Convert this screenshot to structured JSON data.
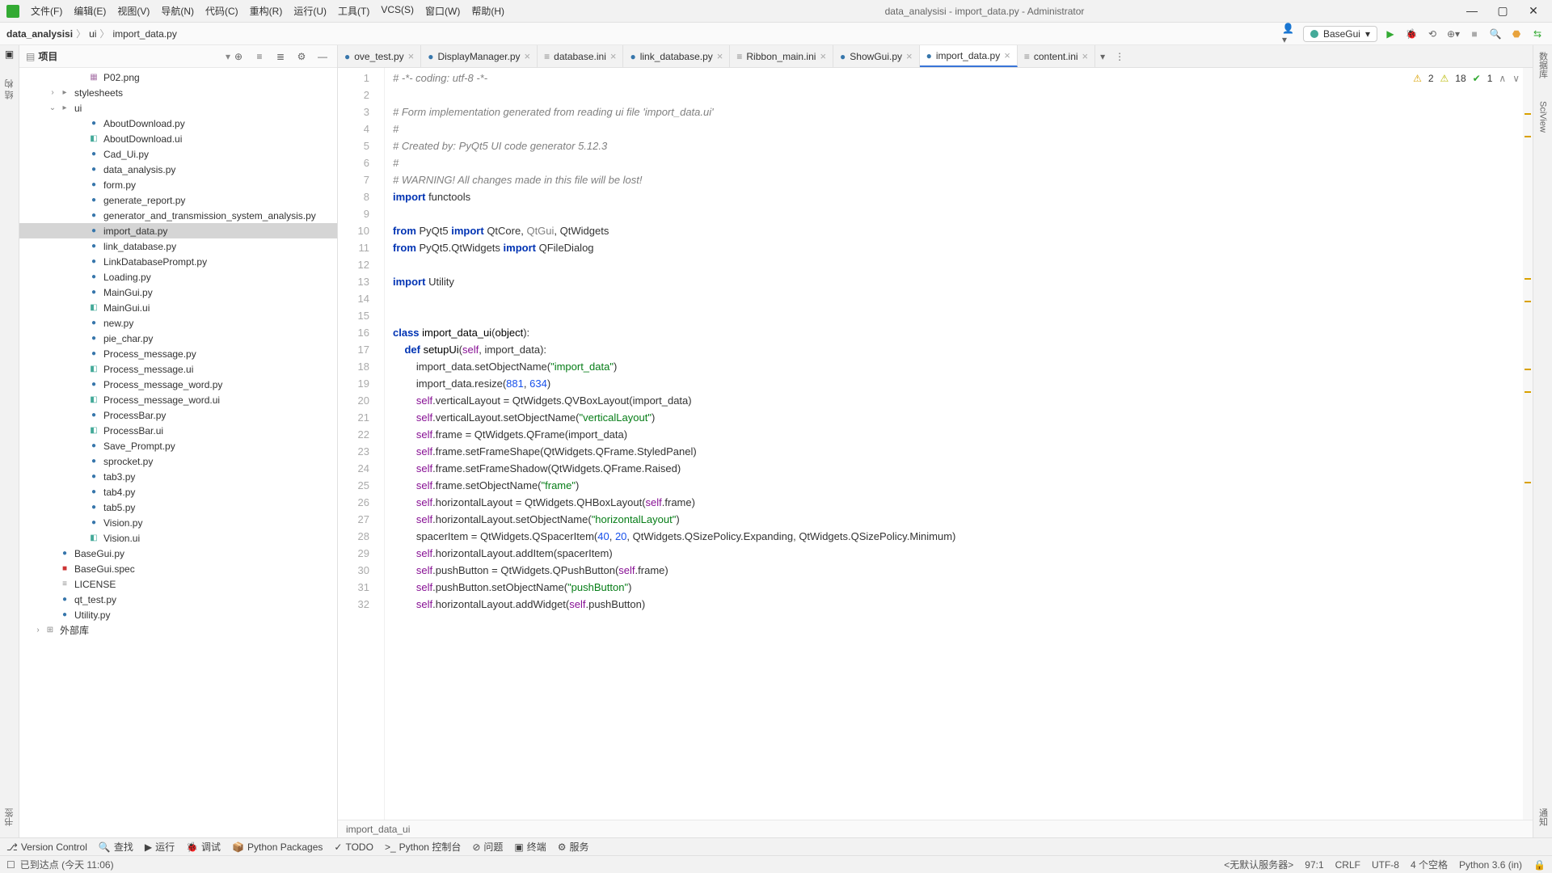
{
  "title": "data_analysisi - import_data.py - Administrator",
  "menus": [
    "文件(F)",
    "编辑(E)",
    "视图(V)",
    "导航(N)",
    "代码(C)",
    "重构(R)",
    "运行(U)",
    "工具(T)",
    "VCS(S)",
    "窗口(W)",
    "帮助(H)"
  ],
  "breadcrumb": [
    "data_analysisi",
    "ui",
    "import_data.py"
  ],
  "run_config": "BaseGui",
  "sidebar": {
    "title": "项目"
  },
  "left_gutter": [
    "结 构",
    "书签",
    "收藏夹"
  ],
  "right_gutter": [
    "数据库",
    "SciView",
    "通知"
  ],
  "tree": [
    {
      "depth": 3,
      "icon": "img",
      "name": "P02.png"
    },
    {
      "depth": 1,
      "icon": "folder",
      "name": "stylesheets",
      "exp": ">"
    },
    {
      "depth": 1,
      "icon": "folder",
      "name": "ui",
      "exp": "v"
    },
    {
      "depth": 3,
      "icon": "py",
      "name": "AboutDownload.py"
    },
    {
      "depth": 3,
      "icon": "ui",
      "name": "AboutDownload.ui"
    },
    {
      "depth": 3,
      "icon": "py",
      "name": "Cad_Ui.py"
    },
    {
      "depth": 3,
      "icon": "py",
      "name": "data_analysis.py"
    },
    {
      "depth": 3,
      "icon": "py",
      "name": "form.py"
    },
    {
      "depth": 3,
      "icon": "py",
      "name": "generate_report.py"
    },
    {
      "depth": 3,
      "icon": "py",
      "name": "generator_and_transmission_system_analysis.py"
    },
    {
      "depth": 3,
      "icon": "py",
      "name": "import_data.py",
      "selected": true
    },
    {
      "depth": 3,
      "icon": "py",
      "name": "link_database.py"
    },
    {
      "depth": 3,
      "icon": "py",
      "name": "LinkDatabasePrompt.py"
    },
    {
      "depth": 3,
      "icon": "py",
      "name": "Loading.py"
    },
    {
      "depth": 3,
      "icon": "py",
      "name": "MainGui.py"
    },
    {
      "depth": 3,
      "icon": "ui",
      "name": "MainGui.ui"
    },
    {
      "depth": 3,
      "icon": "py",
      "name": "new.py"
    },
    {
      "depth": 3,
      "icon": "py",
      "name": "pie_char.py"
    },
    {
      "depth": 3,
      "icon": "py",
      "name": "Process_message.py"
    },
    {
      "depth": 3,
      "icon": "ui",
      "name": "Process_message.ui"
    },
    {
      "depth": 3,
      "icon": "py",
      "name": "Process_message_word.py"
    },
    {
      "depth": 3,
      "icon": "ui",
      "name": "Process_message_word.ui"
    },
    {
      "depth": 3,
      "icon": "py",
      "name": "ProcessBar.py"
    },
    {
      "depth": 3,
      "icon": "ui",
      "name": "ProcessBar.ui"
    },
    {
      "depth": 3,
      "icon": "py",
      "name": "Save_Prompt.py"
    },
    {
      "depth": 3,
      "icon": "py",
      "name": "sprocket.py"
    },
    {
      "depth": 3,
      "icon": "py",
      "name": "tab3.py"
    },
    {
      "depth": 3,
      "icon": "py",
      "name": "tab4.py"
    },
    {
      "depth": 3,
      "icon": "py",
      "name": "tab5.py"
    },
    {
      "depth": 3,
      "icon": "py",
      "name": "Vision.py"
    },
    {
      "depth": 3,
      "icon": "ui",
      "name": "Vision.ui"
    },
    {
      "depth": 1,
      "icon": "py",
      "name": "BaseGui.py"
    },
    {
      "depth": 1,
      "icon": "red",
      "name": "BaseGui.spec"
    },
    {
      "depth": 1,
      "icon": "txt",
      "name": "LICENSE"
    },
    {
      "depth": 1,
      "icon": "py",
      "name": "qt_test.py"
    },
    {
      "depth": 1,
      "icon": "py",
      "name": "Utility.py"
    },
    {
      "depth": 0,
      "icon": "lib",
      "name": "外部库",
      "exp": ">"
    }
  ],
  "tabs": [
    {
      "label": "ove_test.py",
      "icon": "py"
    },
    {
      "label": "DisplayManager.py",
      "icon": "py"
    },
    {
      "label": "database.ini",
      "icon": "ini"
    },
    {
      "label": "link_database.py",
      "icon": "py"
    },
    {
      "label": "Ribbon_main.ini",
      "icon": "ini"
    },
    {
      "label": "ShowGui.py",
      "icon": "py"
    },
    {
      "label": "import_data.py",
      "icon": "py",
      "active": true
    },
    {
      "label": "content.ini",
      "icon": "ini"
    }
  ],
  "inspections": {
    "warn": "2",
    "weak": "18",
    "ok": "1"
  },
  "code_lines": [
    {
      "n": 1,
      "html": "<span class='c'># -*- coding: utf-8 -*-</span>"
    },
    {
      "n": 2,
      "html": ""
    },
    {
      "n": 3,
      "html": "<span class='c'># Form implementation generated from reading ui file 'import_data.ui'</span>"
    },
    {
      "n": 4,
      "html": "<span class='c'>#</span>"
    },
    {
      "n": 5,
      "html": "<span class='c'># Created by: PyQt5 UI code generator 5.12.3</span>"
    },
    {
      "n": 6,
      "html": "<span class='c'>#</span>"
    },
    {
      "n": 7,
      "html": "<span class='c'># WARNING! All changes made in this file will be lost!</span>"
    },
    {
      "n": 8,
      "html": "<span class='k'>import</span> functools"
    },
    {
      "n": 9,
      "html": ""
    },
    {
      "n": 10,
      "html": "<span class='k'>from</span> PyQt5 <span class='k'>import</span> QtCore, <span class='un'>QtGui</span>, QtWidgets"
    },
    {
      "n": 11,
      "html": "<span class='k'>from</span> PyQt5.QtWidgets <span class='k'>import</span> QFileDialog"
    },
    {
      "n": 12,
      "html": ""
    },
    {
      "n": 13,
      "html": "<span class='k'>import</span> Utility"
    },
    {
      "n": 14,
      "html": ""
    },
    {
      "n": 15,
      "html": ""
    },
    {
      "n": 16,
      "html": "<span class='k'>class</span> <span class='n'>import_data_ui</span>(<span class='n'>object</span>):"
    },
    {
      "n": 17,
      "html": "    <span class='k'>def</span> <span class='f'>setupUi</span>(<span class='p'>self</span>, import_data):"
    },
    {
      "n": 18,
      "html": "        import_data.setObjectName(<span class='s'>\"import_data\"</span>)"
    },
    {
      "n": 19,
      "html": "        import_data.resize(<span class='num'>881</span>, <span class='num'>634</span>)"
    },
    {
      "n": 20,
      "html": "        <span class='p'>self</span>.verticalLayout = QtWidgets.QVBoxLayout(import_data)"
    },
    {
      "n": 21,
      "html": "        <span class='p'>self</span>.verticalLayout.setObjectName(<span class='s'>\"verticalLayout\"</span>)"
    },
    {
      "n": 22,
      "html": "        <span class='p'>self</span>.frame = QtWidgets.QFrame(import_data)"
    },
    {
      "n": 23,
      "html": "        <span class='p'>self</span>.frame.setFrameShape(QtWidgets.QFrame.StyledPanel)"
    },
    {
      "n": 24,
      "html": "        <span class='p'>self</span>.frame.setFrameShadow(QtWidgets.QFrame.Raised)"
    },
    {
      "n": 25,
      "html": "        <span class='p'>self</span>.frame.setObjectName(<span class='s'>\"frame\"</span>)"
    },
    {
      "n": 26,
      "html": "        <span class='p'>self</span>.horizontalLayout = QtWidgets.QHBoxLayout(<span class='p'>self</span>.frame)"
    },
    {
      "n": 27,
      "html": "        <span class='p'>self</span>.horizontalLayout.setObjectName(<span class='s'>\"horizontalLayout\"</span>)"
    },
    {
      "n": 28,
      "html": "        spacerItem = QtWidgets.QSpacerItem(<span class='num'>40</span>, <span class='num'>20</span>, QtWidgets.QSizePolicy.Expanding, QtWidgets.QSizePolicy.Minimum)"
    },
    {
      "n": 29,
      "html": "        <span class='p'>self</span>.horizontalLayout.addItem(spacerItem)"
    },
    {
      "n": 30,
      "html": "        <span class='p'>self</span>.pushButton = QtWidgets.QPushButton(<span class='p'>self</span>.frame)"
    },
    {
      "n": 31,
      "html": "        <span class='p'>self</span>.pushButton.setObjectName(<span class='s'>\"pushButton\"</span>)"
    },
    {
      "n": 32,
      "html": "        <span class='p'>self</span>.horizontalLayout.addWidget(<span class='p'>self</span>.pushButton)"
    }
  ],
  "crumb": "import_data_ui",
  "bottombar": [
    "Version Control",
    "查找",
    "运行",
    "调试",
    "Python Packages",
    "TODO",
    "Python 控制台",
    "问题",
    "终端",
    "服务"
  ],
  "status": {
    "left": "已到达点 (今天 11:06)",
    "server": "<无默认服务器>",
    "pos": "97:1",
    "sep": "CRLF",
    "enc": "UTF-8",
    "indent": "4 个空格",
    "python": "Python 3.6 (in)"
  }
}
